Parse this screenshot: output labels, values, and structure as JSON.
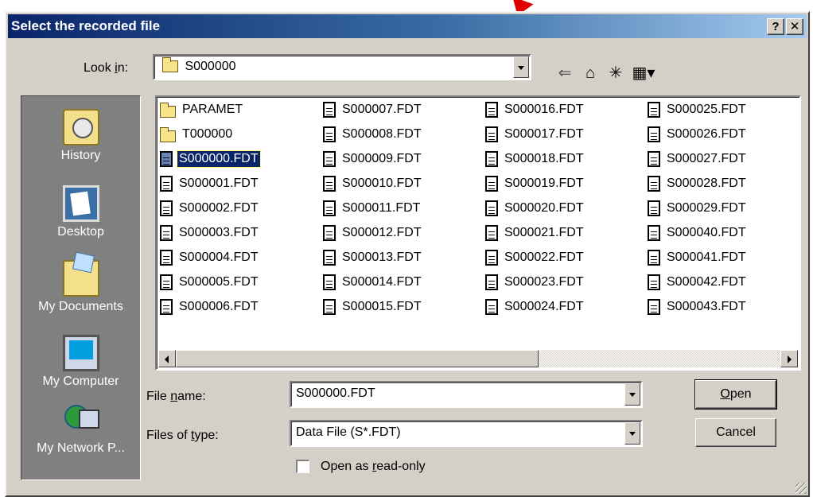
{
  "dialog": {
    "title": "Select the recorded file",
    "help_label": "?",
    "close_label": "✕"
  },
  "look_in": {
    "label_pre": "Look ",
    "label_key": "i",
    "label_post": "n:",
    "value": "S000000",
    "icons": [
      "back-arrow-icon",
      "up-folder-icon",
      "new-folder-icon",
      "view-menu-icon"
    ]
  },
  "places": [
    {
      "label": "History",
      "icon": "history-icon"
    },
    {
      "label": "Desktop",
      "icon": "desktop-icon"
    },
    {
      "label": "My Documents",
      "icon": "my-documents-icon"
    },
    {
      "label": "My Computer",
      "icon": "my-computer-icon"
    },
    {
      "label": "My Network P...",
      "icon": "network-places-icon"
    }
  ],
  "files": {
    "col1": [
      "PARAMET",
      "T000000",
      "S000000.FDT",
      "S000001.FDT",
      "S000002.FDT",
      "S000003.FDT",
      "S000004.FDT",
      "S000005.FDT",
      "S000006.FDT"
    ],
    "col2": [
      "S000007.FDT",
      "S000008.FDT",
      "S000009.FDT",
      "S000010.FDT",
      "S000011.FDT",
      "S000012.FDT",
      "S000013.FDT",
      "S000014.FDT",
      "S000015.FDT"
    ],
    "col3": [
      "S000016.FDT",
      "S000017.FDT",
      "S000018.FDT",
      "S000019.FDT",
      "S000020.FDT",
      "S000021.FDT",
      "S000022.FDT",
      "S000023.FDT",
      "S000024.FDT"
    ],
    "col4": [
      "S000025.FDT",
      "S000026.FDT",
      "S000027.FDT",
      "S000028.FDT",
      "S000029.FDT",
      "S000040.FDT",
      "S000041.FDT",
      "S000042.FDT",
      "S000043.FDT"
    ],
    "selected": "S000000.FDT"
  },
  "file_name": {
    "label_pre": "File ",
    "label_key": "n",
    "label_post": "ame:",
    "value": "S000000.FDT"
  },
  "file_type": {
    "label_pre": "Files of ",
    "label_key": "t",
    "label_post": "ype:",
    "value": "Data File (S*.FDT)"
  },
  "read_only": {
    "label_pre": "Open as ",
    "label_key": "r",
    "label_post": "ead-only",
    "checked": false
  },
  "buttons": {
    "open_key": "O",
    "open_rest": "pen",
    "cancel": "Cancel"
  }
}
